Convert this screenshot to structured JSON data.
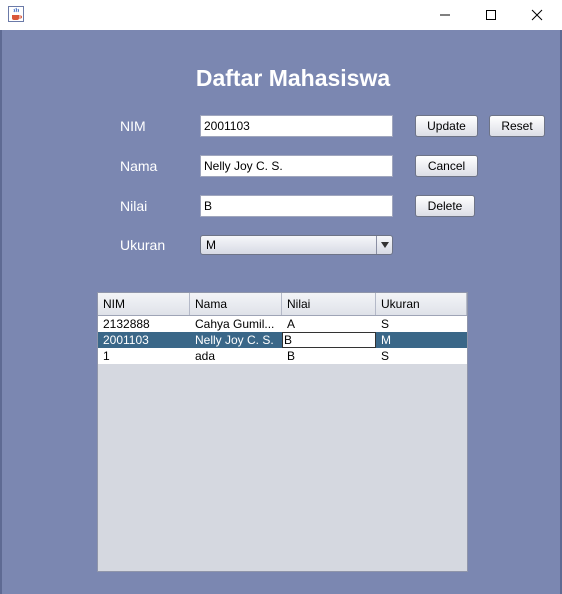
{
  "window": {
    "icon": "java-coffee-cup-icon",
    "controls": [
      "minimize-icon",
      "maximize-icon",
      "close-icon"
    ]
  },
  "form": {
    "title": "Daftar Mahasiswa",
    "nim_label": "NIM",
    "nim_value": "2001103",
    "nama_label": "Nama",
    "nama_value": "Nelly Joy C. S.",
    "nilai_label": "Nilai",
    "nilai_value": "B",
    "ukuran_label": "Ukuran",
    "ukuran_value": "M"
  },
  "buttons": {
    "update": "Update",
    "reset": "Reset",
    "cancel": "Cancel",
    "delete": "Delete"
  },
  "table": {
    "columns": [
      "NIM",
      "Nama",
      "Nilai",
      "Ukuran"
    ],
    "rows": [
      [
        "2132888",
        "Cahya Gumil...",
        "A",
        "S"
      ],
      [
        "2001103",
        "Nelly Joy C. S.",
        "B",
        "M"
      ],
      [
        "1",
        "ada",
        "B",
        "S"
      ]
    ],
    "selected_row": 1
  },
  "colors": {
    "background": "#7b87b1",
    "selection": "#3a6788"
  }
}
